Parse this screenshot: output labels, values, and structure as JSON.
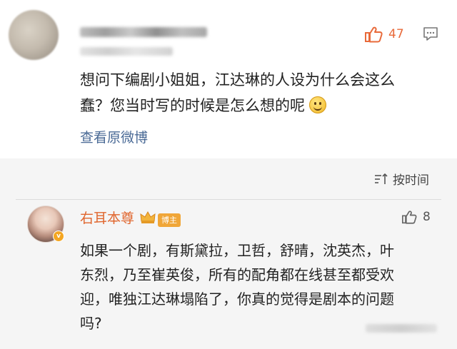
{
  "post": {
    "likes": "47",
    "text_line1": "想问下编剧小姐姐，江达琳的人设为什么会这么",
    "text_line2": "蠢？您当时写的时候是怎么想的呢",
    "emoji": "smile-emoji",
    "view_original": "查看原微博"
  },
  "comments": {
    "sort_label": "按时间",
    "items": [
      {
        "author": "右耳本尊",
        "badge": "博主",
        "likes": "8",
        "text_line1": "如果一个剧，有斯黛拉，卫哲，舒晴，沈英杰，叶",
        "text_line2": "东烈，乃至崔英俊，所有的配角都在线甚至都受欢",
        "text_line3": "迎，唯独江达琳塌陷了，你真的觉得是剧本的问题",
        "text_line4": "吗?"
      }
    ]
  },
  "colors": {
    "accent_orange": "#e0662e",
    "link_blue": "#4a6a96",
    "badge_orange": "#f0a638",
    "comments_bg": "#f5f5f5"
  }
}
